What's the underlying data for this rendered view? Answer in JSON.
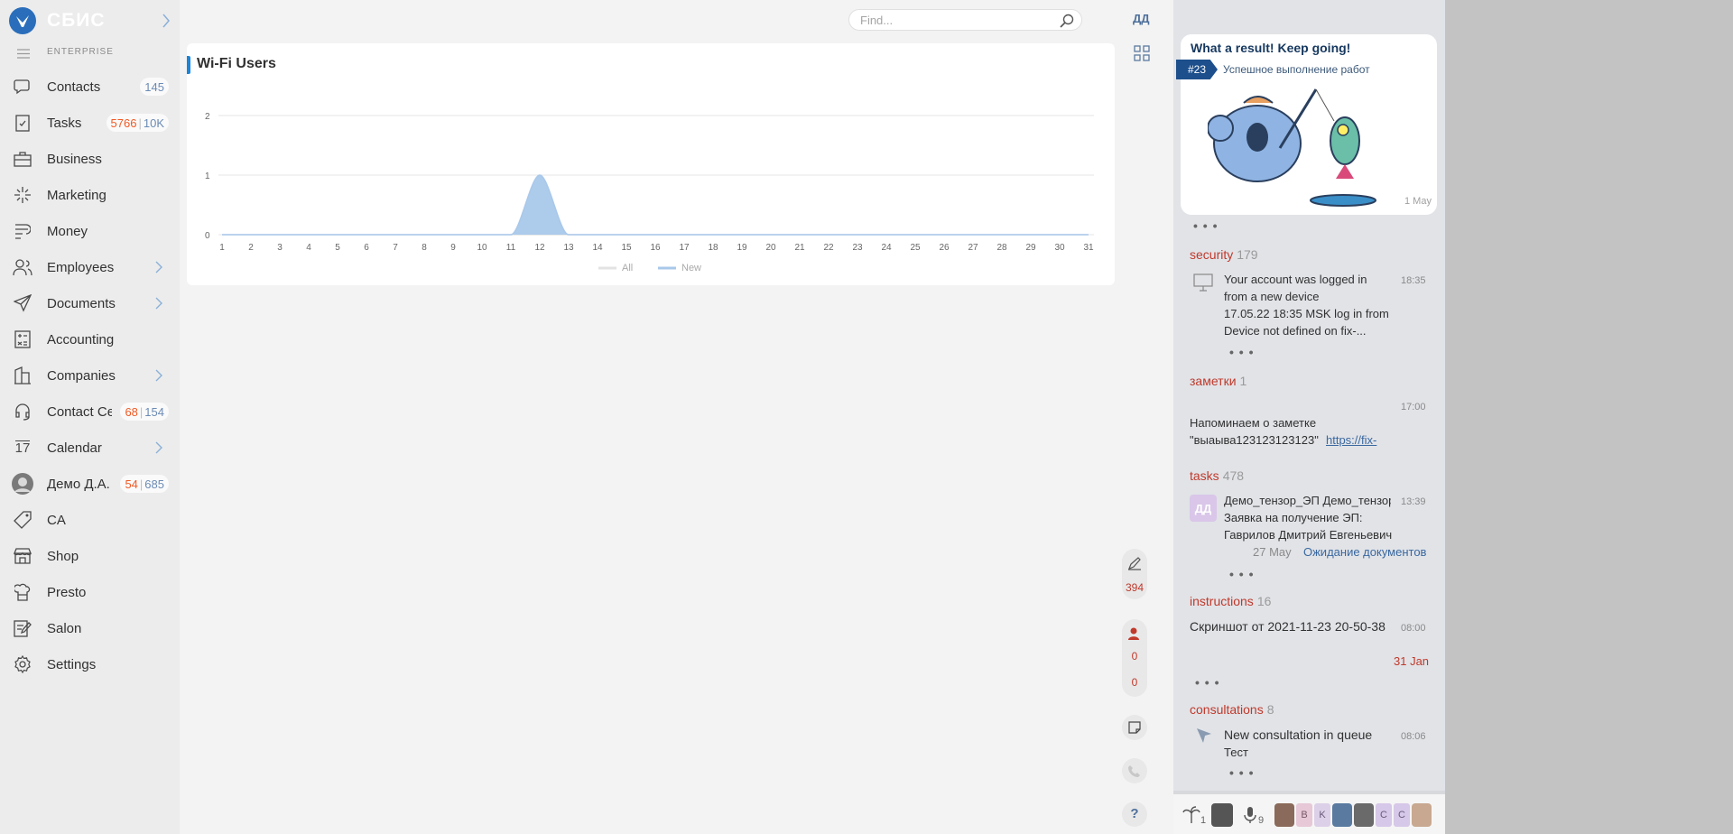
{
  "app": {
    "logo_text": "СБИС",
    "edition": "ENTERPRISE"
  },
  "sidebar": {
    "items": [
      {
        "label": "Contacts",
        "counter": [
          "145"
        ]
      },
      {
        "label": "Tasks",
        "counter": [
          "5766",
          "10K"
        ]
      },
      {
        "label": "Business"
      },
      {
        "label": "Marketing"
      },
      {
        "label": "Money"
      },
      {
        "label": "Employees",
        "has_submenu": true
      },
      {
        "label": "Documents",
        "has_submenu": true
      },
      {
        "label": "Accounting"
      },
      {
        "label": "Companies",
        "has_submenu": true
      },
      {
        "label": "Contact Center",
        "counter": [
          "68",
          "154"
        ]
      },
      {
        "label": "Calendar",
        "has_submenu": true
      },
      {
        "label": "Демо Д.А.",
        "counter": [
          "54",
          "685"
        ]
      },
      {
        "label": "CA"
      },
      {
        "label": "Shop"
      },
      {
        "label": "Presto"
      },
      {
        "label": "Salon"
      },
      {
        "label": "Settings"
      }
    ],
    "calendar_day": "17"
  },
  "header": {
    "search_placeholder": "Find...",
    "user_initials": "ДД"
  },
  "widget": {
    "title": "Wi-Fi Users"
  },
  "chart_data": {
    "type": "area",
    "x": [
      1,
      2,
      3,
      4,
      5,
      6,
      7,
      8,
      9,
      10,
      11,
      12,
      13,
      14,
      15,
      16,
      17,
      18,
      19,
      20,
      21,
      22,
      23,
      24,
      25,
      26,
      27,
      28,
      29,
      30,
      31
    ],
    "series": [
      {
        "name": "All",
        "values": [
          0,
          0,
          0,
          0,
          0,
          0,
          0,
          0,
          0,
          0,
          0,
          0,
          0,
          0,
          0,
          0,
          0,
          0,
          0,
          0,
          0,
          0,
          0,
          0,
          0,
          0,
          0,
          0,
          0,
          0,
          0
        ]
      },
      {
        "name": "New",
        "values": [
          0,
          0,
          0,
          0,
          0,
          0,
          0,
          0,
          0,
          0,
          0,
          1,
          0,
          0,
          0,
          0,
          0,
          0,
          0,
          0,
          0,
          0,
          0,
          0,
          0,
          0,
          0,
          0,
          0,
          0,
          0
        ]
      }
    ],
    "yticks": [
      "0",
      "1",
      "2"
    ],
    "ylim": [
      0,
      2
    ],
    "grid": true,
    "legend": "bottom-center",
    "colors": {
      "All": "#e3e3e3",
      "New": "#a9c8ea"
    }
  },
  "floating": {
    "count_394": "394",
    "count_a": "0",
    "count_b": "0",
    "help": "?"
  },
  "right_panel": {
    "kudos": {
      "title": "What a result! Keep going!",
      "badge": "#23",
      "subtitle": "Успешное выполнение работ",
      "date": "1 May"
    },
    "security": {
      "title": "security",
      "count": "179",
      "event_title": "Your account was logged in from a new device",
      "event_time": "18:35",
      "event_body": "17.05.22 18:35 MSK log in from Device not defined on fix-..."
    },
    "notes": {
      "title": "заметки",
      "count": "1",
      "time": "17:00",
      "text": "Напоминаем о заметке \"выаыва123123123123\"",
      "link": "https://fix-"
    },
    "tasks": {
      "title": "tasks",
      "count": "478",
      "avatar": "ДД",
      "author": "Демо_тензор_ЭП Демо_тензор",
      "time": "13:39",
      "text": "Заявка на получение ЭП: Гаврилов Дмитрий Евгеньевич",
      "date": "27 May",
      "status": "Ожидание документов"
    },
    "instructions": {
      "title": "instructions",
      "count": "16",
      "text": "Скриншот от 2021-11-23 20-50-38",
      "time": "08:00",
      "date": "31 Jan"
    },
    "consultations": {
      "title": "consultations",
      "count": "8",
      "text": "New consultation in queue",
      "time": "08:06",
      "sub": "Тест"
    },
    "bottom_bar": {
      "count_1": "1",
      "count_9": "9",
      "letters": [
        "B",
        "K",
        "C",
        "C"
      ]
    }
  }
}
